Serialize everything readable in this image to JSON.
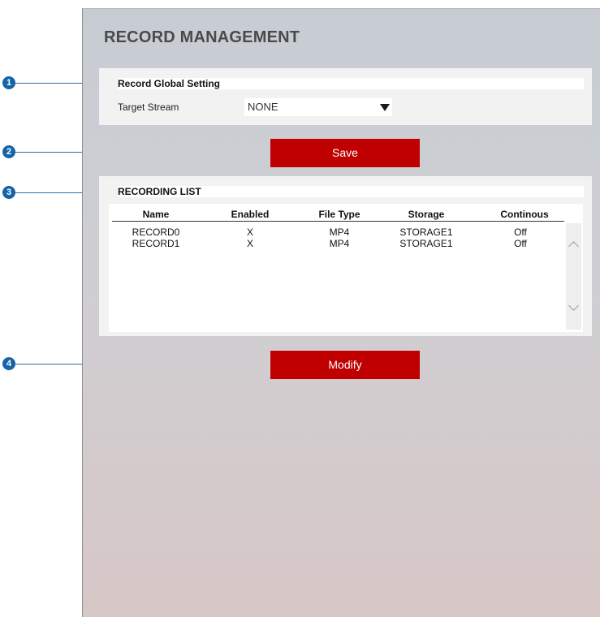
{
  "page": {
    "title": "RECORD MANAGEMENT"
  },
  "global_setting": {
    "header": "Record Global Setting",
    "target_stream_label": "Target Stream",
    "target_stream_value": "NONE"
  },
  "buttons": {
    "save_label": "Save",
    "modify_label": "Modify"
  },
  "recording_list": {
    "header": "RECORDING LIST",
    "columns": [
      "Name",
      "Enabled",
      "File Type",
      "Storage",
      "Continous"
    ],
    "rows": [
      [
        "RECORD0",
        "X",
        "MP4",
        "STORAGE1",
        "Off"
      ],
      [
        "RECORD1",
        "X",
        "MP4",
        "STORAGE1",
        "Off"
      ]
    ]
  },
  "callouts": [
    "1",
    "2",
    "3",
    "4"
  ],
  "colors": {
    "button": "#c00000",
    "callout": "#1564a8"
  },
  "icons": {
    "dropdown": "triangle-down-icon",
    "scroll_up": "chevron-up-icon",
    "scroll_down": "chevron-down-icon"
  }
}
